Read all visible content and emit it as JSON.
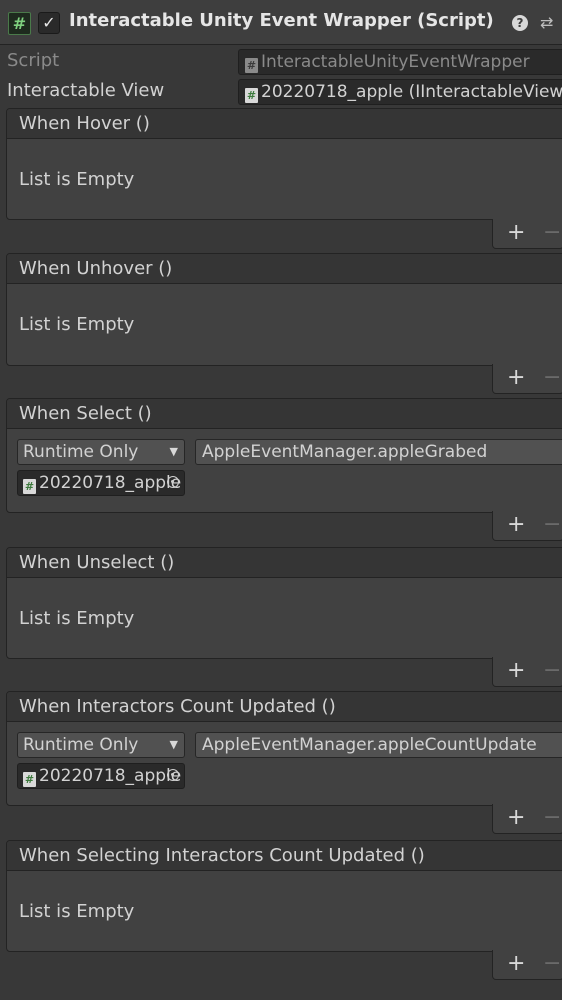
{
  "component": {
    "title": "Interactable Unity Event Wrapper (Script)",
    "enabled_check": "✓",
    "help_icon": "?"
  },
  "properties": {
    "script_label": "Script",
    "script_value": "InteractableUnityEventWrapper",
    "view_label": "Interactable View",
    "view_value": "20220718_apple (IInteractableView"
  },
  "events": [
    {
      "name": "When Hover ()",
      "empty_text": "List is Empty"
    },
    {
      "name": "When Unhover ()",
      "empty_text": "List is Empty"
    },
    {
      "name": "When Select ()",
      "mode": "Runtime Only",
      "method": "AppleEventManager.appleGrabed",
      "target": "20220718_apple"
    },
    {
      "name": "When Unselect ()",
      "empty_text": "List is Empty"
    },
    {
      "name": "When Interactors Count Updated ()",
      "mode": "Runtime Only",
      "method": "AppleEventManager.appleCountUpdate",
      "target": "20220718_apple"
    },
    {
      "name": "When Selecting Interactors Count Updated ()",
      "empty_text": "List is Empty"
    }
  ],
  "buttons": {
    "add": "+",
    "remove": "−"
  }
}
